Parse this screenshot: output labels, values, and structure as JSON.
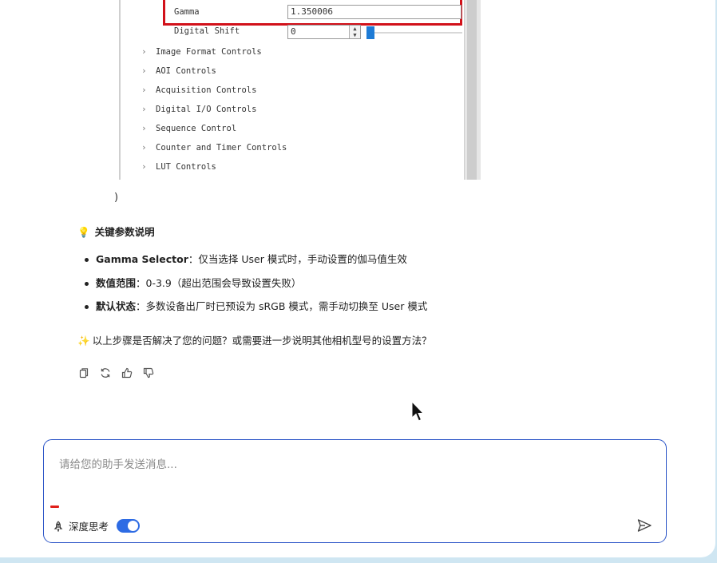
{
  "screenshot": {
    "gamma_label": "Gamma",
    "gamma_value": "1.350006",
    "digital_shift_label": "Digital Shift",
    "digital_shift_value": "0",
    "tree_items": [
      "Image Format Controls",
      "AOI Controls",
      "Acquisition Controls",
      "Digital I/O Controls",
      "Sequence Control",
      "Counter and Timer Controls",
      "LUT Controls"
    ]
  },
  "closing_paren": ")",
  "key_params": {
    "title": "关键参数说明",
    "items": [
      {
        "term": "Gamma Selector",
        "text": "：仅当选择 User 模式时，手动设置的伽马值生效"
      },
      {
        "term": "数值范围",
        "text": "：0-3.9（超出范围会导致设置失败）"
      },
      {
        "term": "默认状态",
        "text": "：多数设备出厂时已预设为 sRGB 模式，需手动切换至 User 模式"
      }
    ]
  },
  "followup": "以上步骤是否解决了您的问题？或需要进一步说明其他相机型号的设置方法？",
  "actions": [
    "copy-icon",
    "regenerate-icon",
    "thumbs-up-icon",
    "thumbs-down-icon"
  ],
  "composer": {
    "placeholder": "请给您的助手发送消息...",
    "deep_think_label": "深度思考",
    "deep_think_enabled": true
  },
  "colors": {
    "accent": "#2d6be4",
    "composer_border": "#2c55c7",
    "highlight_red": "#d2111a",
    "background": "#cfe6f2"
  }
}
